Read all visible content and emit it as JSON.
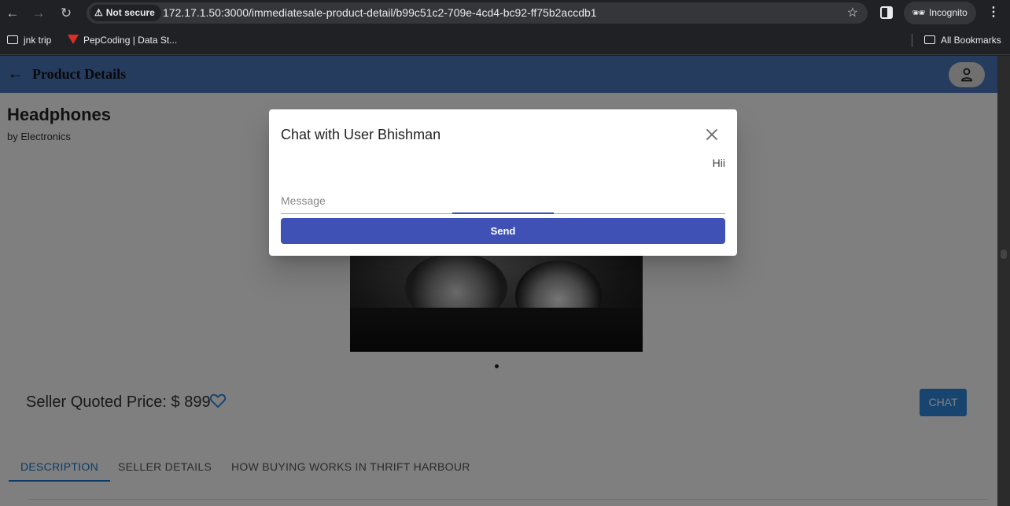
{
  "browser": {
    "security_label": "Not secure",
    "url": "172.17.1.50:3000/immediatesale-product-detail/b99c51c2-709e-4cd4-bc92-ff75b2accdb1",
    "profile_label": "Incognito",
    "bookmarks": [
      {
        "label": "jnk trip",
        "icon": "folder-icon"
      },
      {
        "label": "PepCoding | Data St...",
        "icon": "pepcoding-logo"
      }
    ],
    "all_bookmarks_label": "All Bookmarks"
  },
  "appbar": {
    "title": "Product Details",
    "back_icon": "arrow-left-icon",
    "account_icon": "person-icon",
    "color": "#4a78bd"
  },
  "product": {
    "name": "Headphones",
    "byline": "by Electronics",
    "price_label": "Seller Quoted Price: $ 899",
    "chat_label": "CHAT",
    "favorite_icon": "heart-outline-icon"
  },
  "tabs": [
    {
      "label": "DESCRIPTION",
      "active": true
    },
    {
      "label": "SELLER DETAILS",
      "active": false
    },
    {
      "label": "HOW BUYING WORKS IN THRIFT HARBOUR",
      "active": false
    }
  ],
  "dialog": {
    "title": "Chat with User Bhishman",
    "messages": [
      "Hii"
    ],
    "input_value": "",
    "input_placeholder": "Message",
    "send_label": "Send",
    "accent": "#3f51b5"
  }
}
